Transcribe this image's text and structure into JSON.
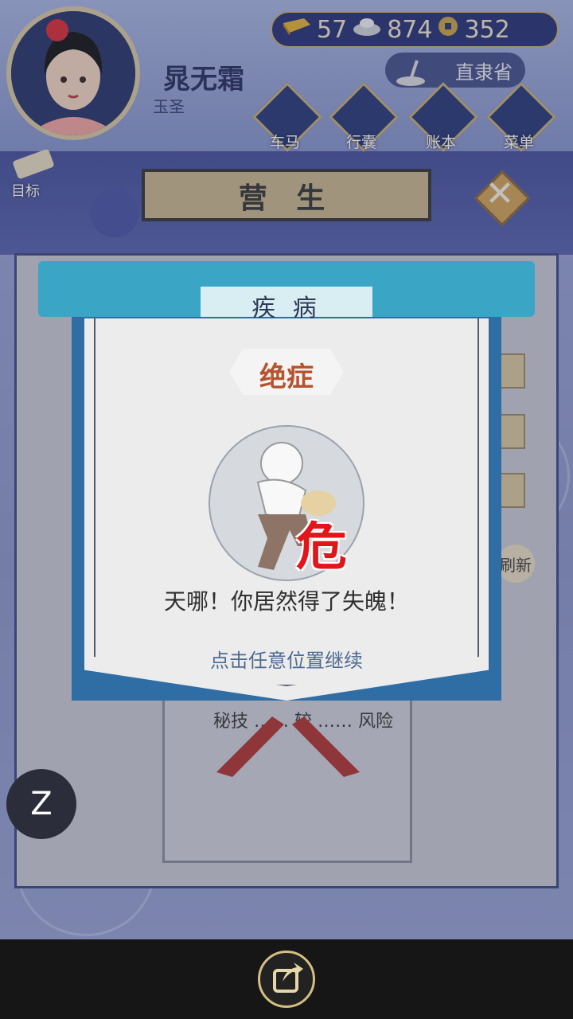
{
  "player": {
    "name": "晁无霜",
    "title": "玉圣"
  },
  "currencies": {
    "gold": "57",
    "silver": "874",
    "coins": "352"
  },
  "location": "直隶省",
  "nav": {
    "carriage": "车马",
    "bag": "行囊",
    "ledger": "账本",
    "menu": "菜单"
  },
  "goal_label": "目标",
  "section_title": "营 生",
  "background_panel": {
    "card_text": "秘技 …… 较 …… 风险",
    "refresh_label": "刷新"
  },
  "modal": {
    "title": "疾 病",
    "severity": "绝症",
    "danger_glyph": "危",
    "message": "天哪！你居然得了失魄！",
    "hint": "点击任意位置继续"
  },
  "z_label": "Z",
  "colors": {
    "accent_blue": "#3aa5c4",
    "danger_red": "#e4141b",
    "severity_text": "#b6522d",
    "gold_border": "#c7b07a"
  }
}
